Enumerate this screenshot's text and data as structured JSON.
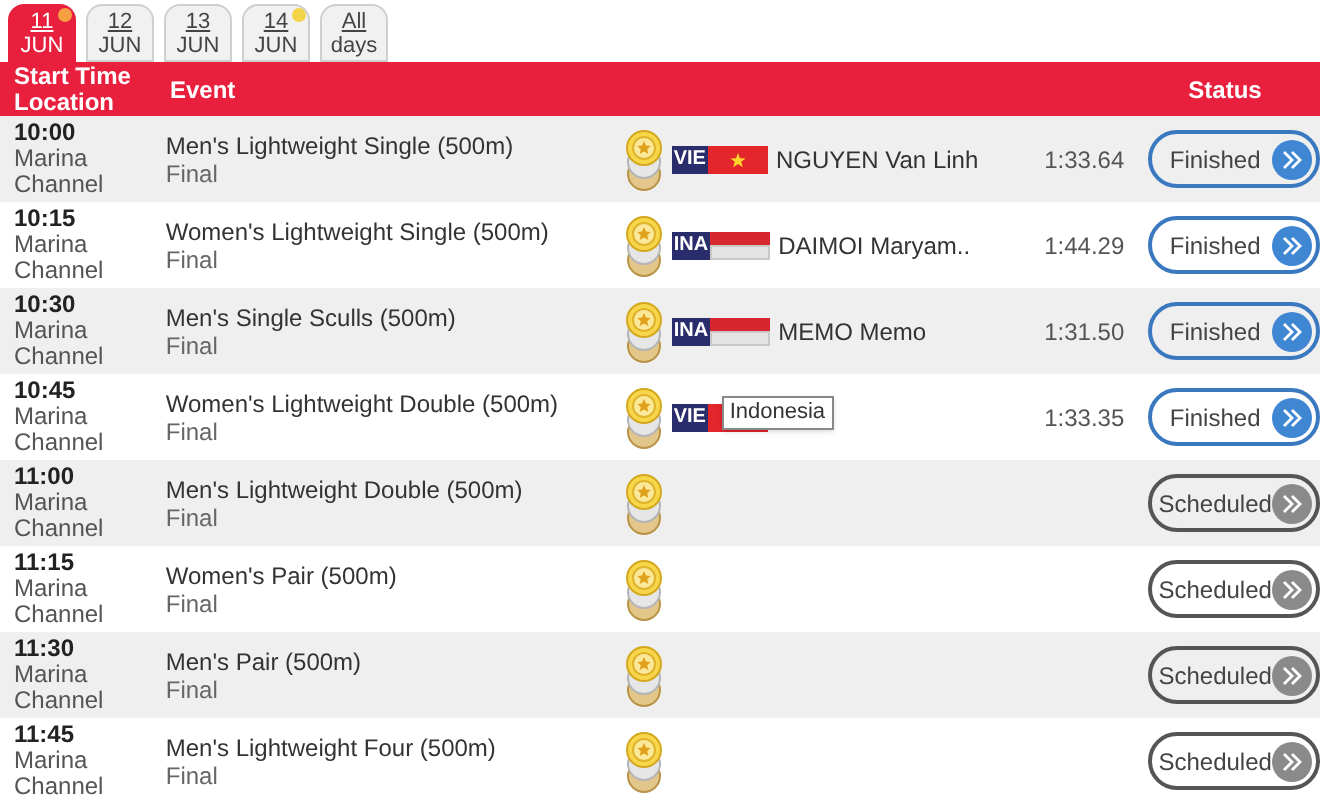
{
  "tabs": [
    {
      "day": "11",
      "month": "JUN",
      "selected": true,
      "dot": true
    },
    {
      "day": "12",
      "month": "JUN",
      "selected": false,
      "dot": false
    },
    {
      "day": "13",
      "month": "JUN",
      "selected": false,
      "dot": false
    },
    {
      "day": "14",
      "month": "JUN",
      "selected": false,
      "dot": true
    },
    {
      "day": "All",
      "month": "days",
      "selected": false,
      "dot": false
    }
  ],
  "columns": {
    "time": "Start Time",
    "location": "Location",
    "event": "Event",
    "status": "Status"
  },
  "rows": [
    {
      "time": "10:00",
      "location": "Marina Channel",
      "event": "Men's Lightweight Single (500m)",
      "phase": "Final",
      "country": "VIE",
      "flag": {
        "kind": "vietnam"
      },
      "athlete": "NGUYEN Van Linh",
      "result": "1:33.64",
      "status": "Finished",
      "kind": "finished"
    },
    {
      "time": "10:15",
      "location": "Marina Channel",
      "event": "Women's Lightweight Single (500m)",
      "phase": "Final",
      "country": "INA",
      "flag": {
        "kind": "indonesia"
      },
      "athlete": "DAIMOI Maryam..",
      "result": "1:44.29",
      "status": "Finished",
      "kind": "finished"
    },
    {
      "time": "10:30",
      "location": "Marina Channel",
      "event": "Men's Single Sculls (500m)",
      "phase": "Final",
      "country": "INA",
      "flag": {
        "kind": "indonesia"
      },
      "athlete": "MEMO Memo",
      "result": "1:31.50",
      "status": "Finished",
      "kind": "finished"
    },
    {
      "time": "10:45",
      "location": "Marina Channel",
      "event": "Women's Lightweight Double (500m)",
      "phase": "Final",
      "country": "VIE",
      "flag": {
        "kind": "vietnam"
      },
      "tooltip": "Indonesia",
      "result": "1:33.35",
      "status": "Finished",
      "kind": "finished"
    },
    {
      "time": "11:00",
      "location": "Marina Channel",
      "event": "Men's Lightweight Double (500m)",
      "phase": "Final",
      "status": "Scheduled",
      "kind": "scheduled"
    },
    {
      "time": "11:15",
      "location": "Marina Channel",
      "event": "Women's Pair (500m)",
      "phase": "Final",
      "status": "Scheduled",
      "kind": "scheduled"
    },
    {
      "time": "11:30",
      "location": "Marina Channel",
      "event": "Men's Pair (500m)",
      "phase": "Final",
      "status": "Scheduled",
      "kind": "scheduled"
    },
    {
      "time": "11:45",
      "location": "Marina Channel",
      "event": "Men's Lightweight Four (500m)",
      "phase": "Final",
      "status": "Scheduled",
      "kind": "scheduled"
    }
  ]
}
